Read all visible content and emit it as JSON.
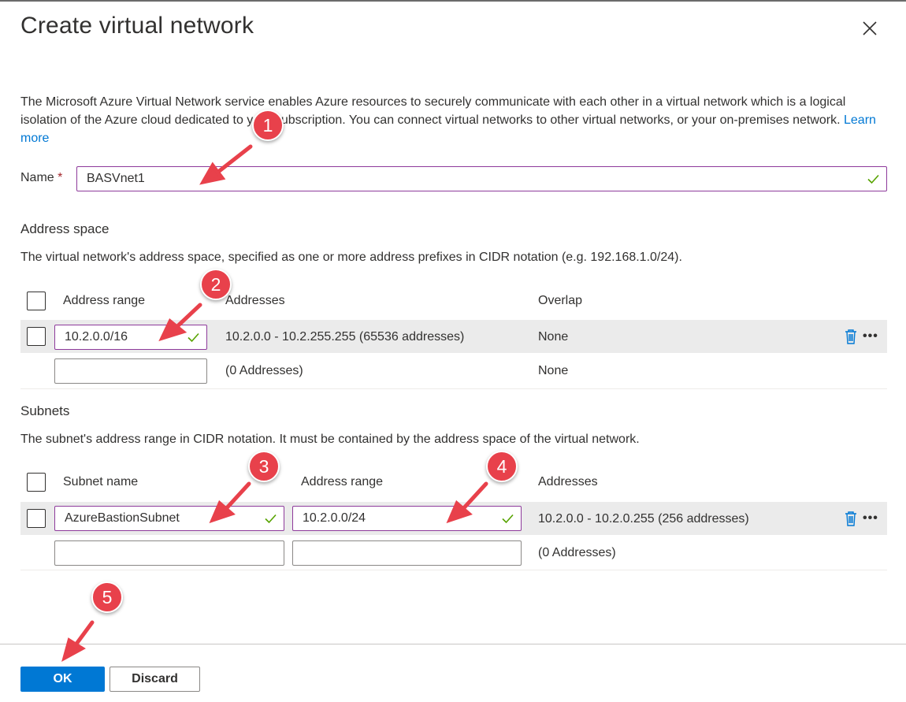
{
  "dialog": {
    "title": "Create virtual network",
    "description": "The Microsoft Azure Virtual Network service enables Azure resources to securely communicate with each other in a virtual network which is a logical isolation of the Azure cloud dedicated to your subscription. You can connect virtual networks to other virtual networks, or your on-premises network.",
    "learn_more": "Learn more"
  },
  "name_field": {
    "label": "Name",
    "required_mark": "*",
    "value": "BASVnet1"
  },
  "address_space": {
    "title": "Address space",
    "description": "The virtual network's address space, specified as one or more address prefixes in CIDR notation (e.g. 192.168.1.0/24).",
    "columns": [
      "Address range",
      "Addresses",
      "Overlap"
    ],
    "rows": [
      {
        "range": "10.2.0.0/16",
        "addresses": "10.2.0.0 - 10.2.255.255 (65536 addresses)",
        "overlap": "None"
      },
      {
        "range": "",
        "addresses": "(0 Addresses)",
        "overlap": "None"
      }
    ]
  },
  "subnets": {
    "title": "Subnets",
    "description": "The subnet's address range in CIDR notation. It must be contained by the address space of the virtual network.",
    "columns": [
      "Subnet name",
      "Address range",
      "Addresses"
    ],
    "rows": [
      {
        "name": "AzureBastionSubnet",
        "range": "10.2.0.0/24",
        "addresses": "10.2.0.0 - 10.2.0.255 (256 addresses)"
      },
      {
        "name": "",
        "range": "",
        "addresses": "(0 Addresses)"
      }
    ]
  },
  "footer": {
    "ok_label": "OK",
    "discard_label": "Discard"
  },
  "more_glyph": "•••",
  "callouts": [
    "1",
    "2",
    "3",
    "4",
    "5"
  ],
  "colors": {
    "accent": "#0078d4",
    "valid_border": "#8e3a9b",
    "valid_check": "#57a300",
    "callout": "#e8414b",
    "required": "#a4262c"
  },
  "icons": [
    "close-icon",
    "check-icon",
    "trash-icon",
    "more-icon"
  ]
}
